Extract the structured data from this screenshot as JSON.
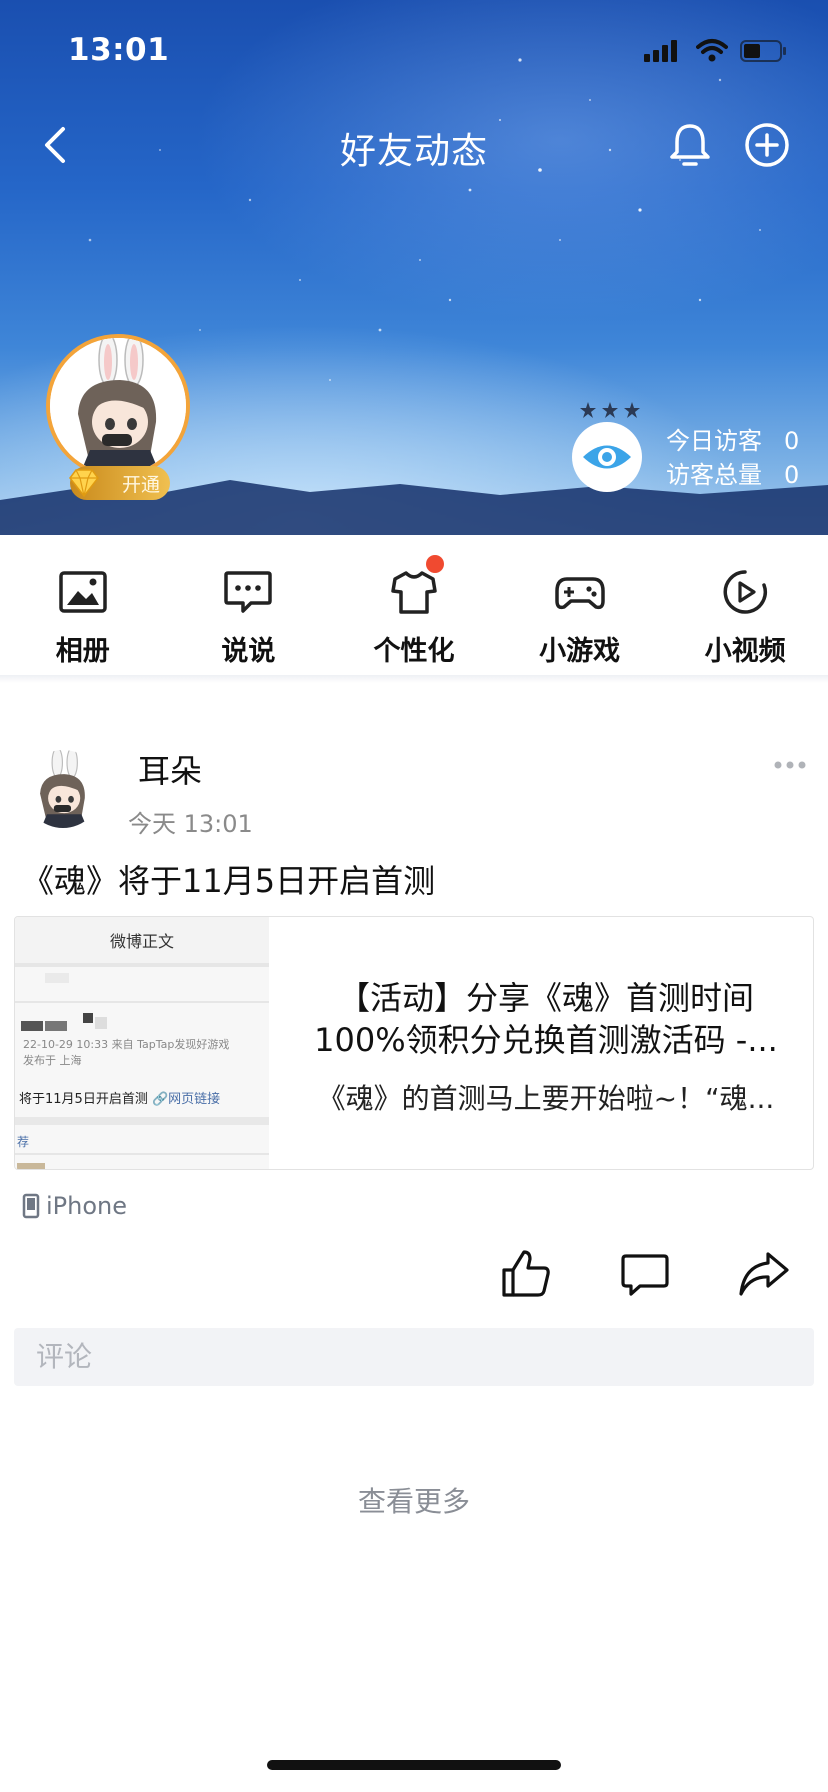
{
  "status_bar": {
    "time": "13:01"
  },
  "nav": {
    "title": "好友动态"
  },
  "profile": {
    "vip_label": "开通"
  },
  "visitors": {
    "today_label": "今日访客",
    "today_count": "0",
    "total_label": "访客总量",
    "total_count": "0"
  },
  "shortcuts": [
    {
      "label": "相册",
      "icon": "photo-album-icon"
    },
    {
      "label": "说说",
      "icon": "speech-bubble-icon"
    },
    {
      "label": "个性化",
      "icon": "tshirt-icon",
      "badge": true
    },
    {
      "label": "小游戏",
      "icon": "gamepad-icon"
    },
    {
      "label": "小视频",
      "icon": "play-circle-icon"
    }
  ],
  "post": {
    "author": "耳朵",
    "time": "今天 13:01",
    "text": "《魂》将于11月5日开启首测",
    "card": {
      "thumb_header": "微博正文",
      "thumb_meta_1": "22-10-29 10:33  来自 TapTap发现好游戏",
      "thumb_meta_2": "发布于 上海",
      "thumb_line": "将于11月5日开启首测",
      "thumb_link": "网页链接",
      "thumb_rec": "荐",
      "title_line_1": "【活动】分享《魂》首测时间",
      "title_line_2": "100%领积分兑换首测激活码 -...",
      "summary": "《魂》的首测马上要开始啦~！“魂..."
    },
    "device": "iPhone",
    "comment_placeholder": "评论"
  },
  "feed": {
    "see_more": "查看更多"
  },
  "colors": {
    "accent_red": "#f04a30",
    "vip_gold": "#f0c050",
    "eye_blue": "#3ba4e8"
  }
}
